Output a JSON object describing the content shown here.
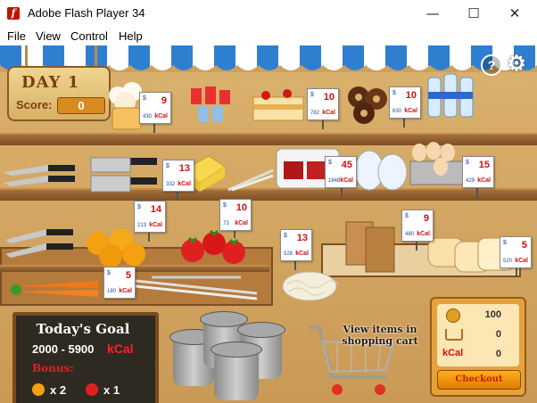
{
  "window": {
    "title": "Adobe Flash Player 34",
    "app_icon_glyph": "f",
    "minimize_glyph": "—",
    "maximize_glyph": "☐",
    "close_glyph": "✕"
  },
  "menu": {
    "items": [
      "File",
      "View",
      "Control",
      "Help"
    ]
  },
  "hud": {
    "day_label": "DAY 1",
    "score_label": "Score:",
    "score_value": "0",
    "help_icon_glyph": "?",
    "settings_icon_glyph": "⚙"
  },
  "price_tags": [
    {
      "item": "ice-cream",
      "price": "9",
      "kcal": "430"
    },
    {
      "item": "cake",
      "price": "10",
      "kcal": "782"
    },
    {
      "item": "donuts",
      "price": "10",
      "kcal": "630"
    },
    {
      "item": "cheese",
      "price": "13",
      "kcal": "332"
    },
    {
      "item": "steak",
      "price": "45",
      "kcal": "1848"
    },
    {
      "item": "eggs",
      "price": "15",
      "kcal": "429"
    },
    {
      "item": "oranges",
      "price": "14",
      "kcal": "213"
    },
    {
      "item": "tomatoes",
      "price": "10",
      "kcal": "73"
    },
    {
      "item": "noodles",
      "price": "13",
      "kcal": "528"
    },
    {
      "item": "paper-bags",
      "price": "9",
      "kcal": "480"
    },
    {
      "item": "bread",
      "price": "5",
      "kcal": "520"
    },
    {
      "item": "carrots",
      "price": "5",
      "kcal": "180"
    }
  ],
  "tag_symbols": {
    "currency": "$",
    "unit": "kCal"
  },
  "goal_board": {
    "title": "Today's Goal",
    "range": "2000 - 5900",
    "unit": "kCal",
    "bonus_label": "Bonus:",
    "bonus_orange_qty": "x 2",
    "bonus_tomato_qty": "x 1"
  },
  "cart_label": "View items in shopping cart",
  "status_panel": {
    "money": "100",
    "items": "0",
    "kcal_label": "kCal",
    "kcal_value": "0",
    "checkout_label": "Checkout"
  },
  "colors": {
    "awning_blue": "#2f7fd0",
    "shelf_wood": "#8a5a2a",
    "wall": "#d4a862",
    "tag_red": "#d01010",
    "tag_blue": "#1a4ea0",
    "board": "#2e2a22",
    "panel": "#e4a23c"
  }
}
